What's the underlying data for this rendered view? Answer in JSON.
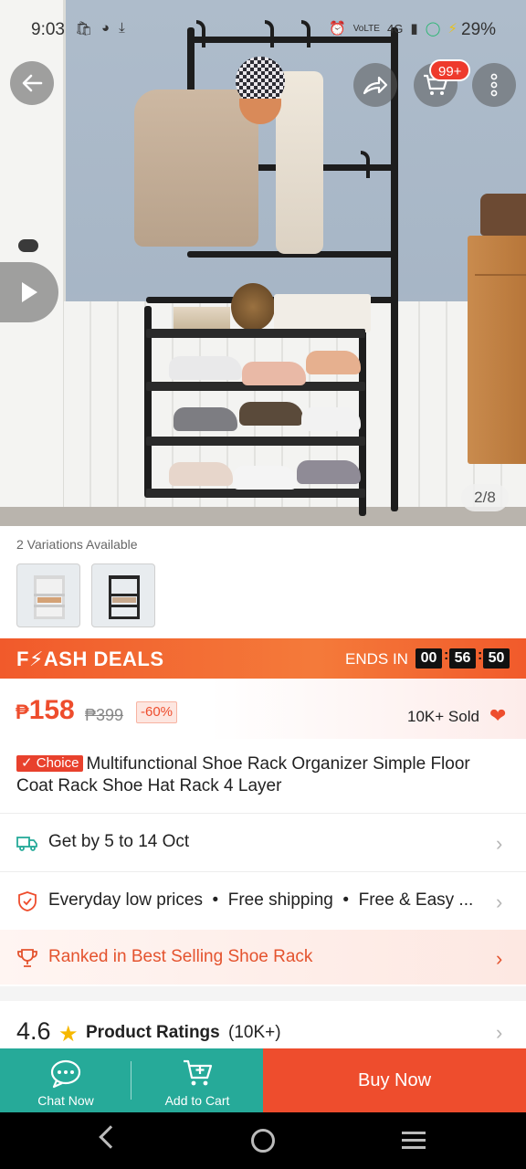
{
  "status_bar": {
    "time": "9:03",
    "left_icons": [
      "shopee-bag-icon",
      "vpn-icon",
      "download-icon"
    ],
    "right_icons": [
      "alarm-icon",
      "volte-icon",
      "signal-4g-icon",
      "data-saver-icon",
      "battery-icon"
    ],
    "network_label": "4G",
    "volte_label": "VoLTE",
    "battery": "29%"
  },
  "hero": {
    "cart_badge": "99+",
    "image_counter": "2/8"
  },
  "variations": {
    "label": "2 Variations Available",
    "count": 2
  },
  "flash_deals": {
    "title": "F⚡ASH DEALS",
    "ends_label": "ENDS IN",
    "timer": {
      "hours": "00",
      "minutes": "56",
      "seconds": "50"
    }
  },
  "pricing": {
    "currency": "₱",
    "price": "158",
    "old_price": "₱399",
    "discount": "-60%",
    "sold": "10K+ Sold"
  },
  "product": {
    "badge": "✓ Choice",
    "title": "Multifunctional Shoe Rack Organizer Simple Floor Coat Rack Shoe Hat Rack 4 Layer"
  },
  "delivery": {
    "text": "Get by 5 to 14 Oct"
  },
  "guarantees": {
    "text": "Everyday low prices  •  Free shipping  •  Free & Easy ..."
  },
  "ranking": {
    "text": "Ranked in Best Selling Shoe Rack"
  },
  "ratings": {
    "score": "4.6",
    "label": "Product Ratings",
    "count": "(10K+)"
  },
  "actions": {
    "chat": "Chat Now",
    "cart": "Add to Cart",
    "buy": "Buy Now"
  },
  "colors": {
    "brand": "#ee4d2d",
    "flash_gradient_start": "#f15a2b",
    "teal": "#26aa99"
  }
}
